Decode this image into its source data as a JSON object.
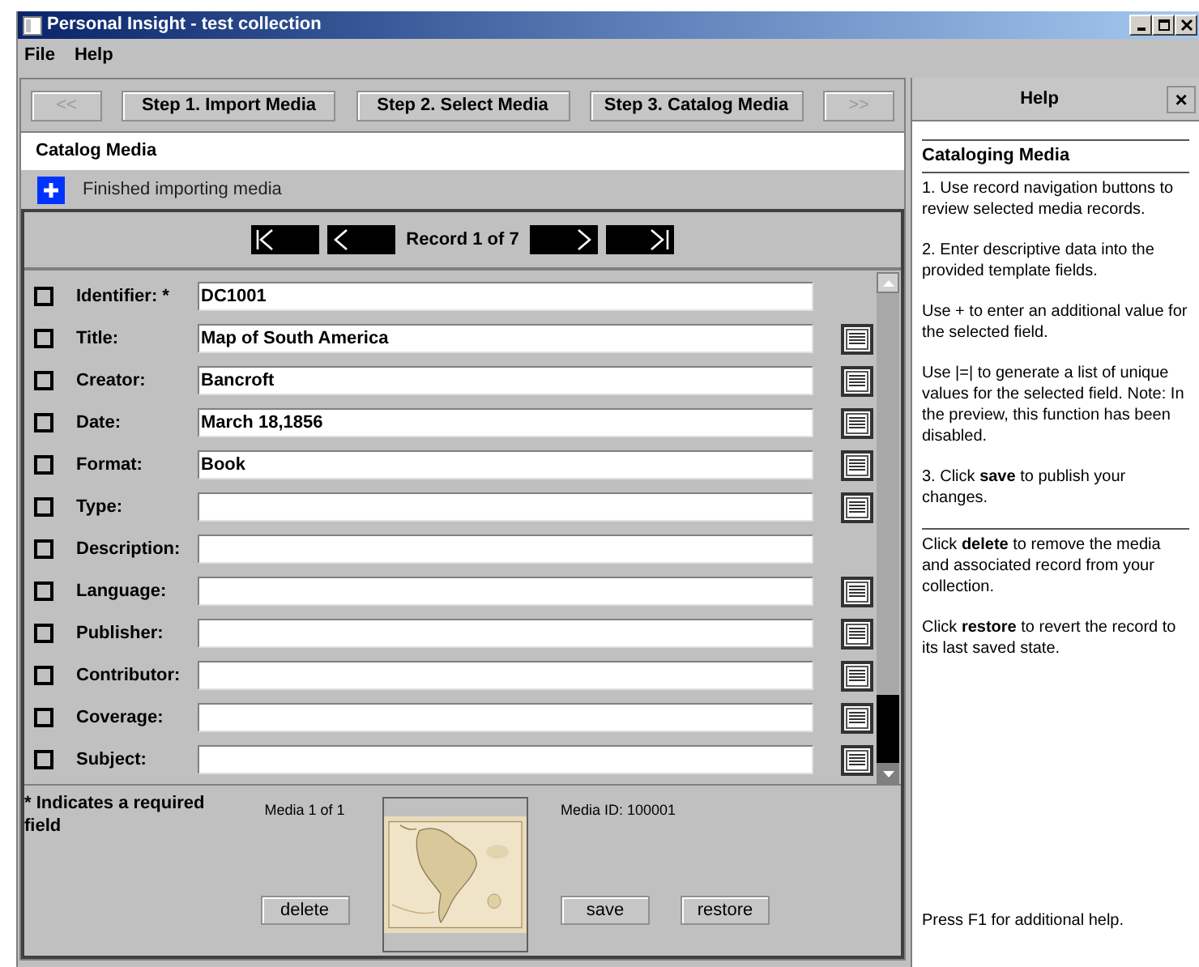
{
  "window": {
    "title": "Personal Insight - test collection"
  },
  "menu": [
    {
      "label": "File"
    },
    {
      "label": "Help"
    }
  ],
  "steps": [
    {
      "label": "<<",
      "disabled": true
    },
    {
      "label": "Step 1. Import Media",
      "disabled": false
    },
    {
      "label": "Step 2. Select Media",
      "disabled": false
    },
    {
      "label": "Step 3. Catalog Media",
      "disabled": false
    },
    {
      "label": ">>",
      "disabled": true
    }
  ],
  "section_title": "Catalog Media",
  "status": {
    "message": "Finished importing media"
  },
  "record_nav": {
    "label": "Record 1 of 7",
    "buttons": [
      {
        "kind": "first"
      },
      {
        "kind": "prev"
      },
      {
        "kind": "next"
      },
      {
        "kind": "last"
      }
    ]
  },
  "fields": [
    {
      "label": "Identifier: *",
      "value": "DC1001",
      "checked": false,
      "list_button": false
    },
    {
      "label": "Title:",
      "value": "Map of South America",
      "checked": false,
      "list_button": true
    },
    {
      "label": "Creator:",
      "value": "Bancroft",
      "checked": false,
      "list_button": true
    },
    {
      "label": "Date:",
      "value": "March 18,1856",
      "checked": false,
      "list_button": true
    },
    {
      "label": "Format:",
      "value": "Book",
      "checked": false,
      "list_button": true
    },
    {
      "label": "Type:",
      "checked": false,
      "list_button": true
    },
    {
      "label": "Description:",
      "checked": false,
      "list_button": false
    },
    {
      "label": "Language:",
      "checked": false,
      "list_button": true
    },
    {
      "label": "Publisher:",
      "checked": false,
      "list_button": true
    },
    {
      "label": "Contributor:",
      "checked": false,
      "list_button": true
    },
    {
      "label": "Coverage:",
      "checked": false,
      "list_button": true
    },
    {
      "label": "Subject:",
      "checked": false,
      "list_button": true
    }
  ],
  "footer": {
    "required_note": "* Indicates a required field",
    "media_count": "Media 1 of 1",
    "media_id": "Media ID: 100001",
    "buttons": [
      "delete",
      "save",
      "restore"
    ]
  },
  "help": {
    "title": "Help",
    "close": "×",
    "heading": "Cataloging Media",
    "sections": [
      [
        "1. Use record navigation buttons to review selected media records.",
        "2. Enter descriptive data into the provided template fields.",
        "Use + to enter an additional value for the selected field.",
        "Use |=| to generate a list of unique values for the selected field. Note: In the preview, this function has been disabled.",
        "3. Click **save** to publish your changes."
      ],
      [
        "Click **delete** to remove the media and associated record from your collection.",
        "Click **restore** to revert the record to its last saved state."
      ]
    ],
    "footer": "Press F1 for additional help."
  }
}
